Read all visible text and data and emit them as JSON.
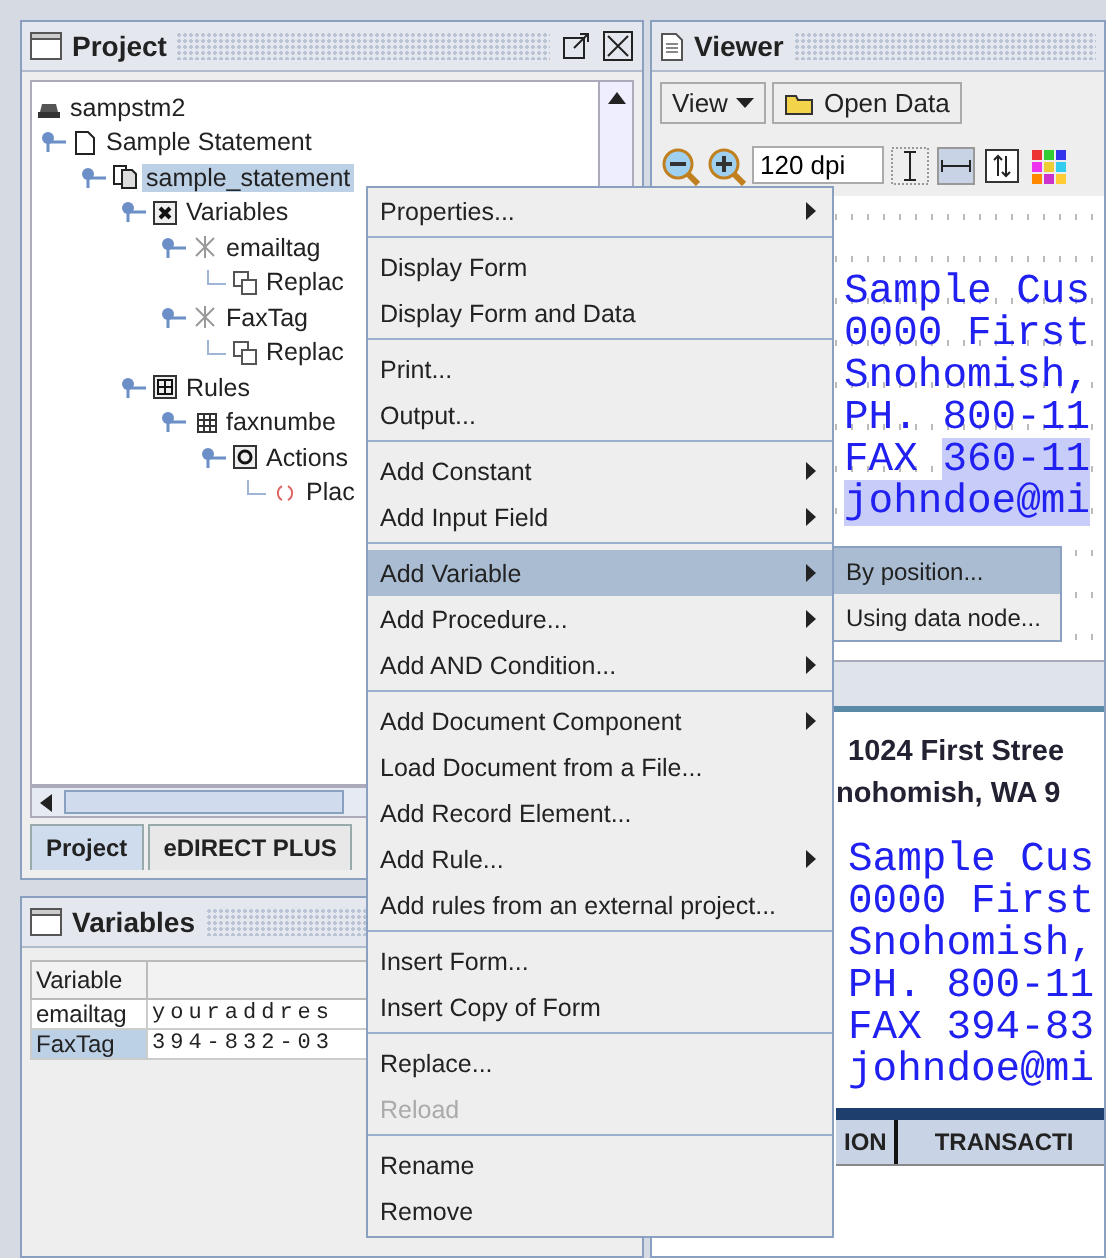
{
  "project_panel": {
    "title": "Project",
    "tree": [
      {
        "label": "sampstm2",
        "kind": "project",
        "selected": false,
        "children": [
          {
            "label": "Sample Statement",
            "kind": "document",
            "selected": false,
            "children": [
              {
                "label": "sample_statement",
                "kind": "form",
                "selected": true,
                "children": [
                  {
                    "label": "Variables",
                    "kind": "variables",
                    "selected": false,
                    "children": [
                      {
                        "label": "emailtag",
                        "kind": "variable",
                        "selected": false,
                        "children": [
                          {
                            "label": "Replac",
                            "kind": "replace",
                            "selected": false
                          }
                        ]
                      },
                      {
                        "label": "FaxTag",
                        "kind": "variable",
                        "selected": false,
                        "children": [
                          {
                            "label": "Replac",
                            "kind": "replace",
                            "selected": false
                          }
                        ]
                      }
                    ]
                  },
                  {
                    "label": "Rules",
                    "kind": "rules",
                    "selected": false,
                    "children": [
                      {
                        "label": "faxnumbe",
                        "kind": "rule",
                        "selected": false,
                        "children": [
                          {
                            "label": "Actions",
                            "kind": "actions",
                            "selected": false,
                            "children": [
                              {
                                "label": "Plac",
                                "kind": "placeholder",
                                "selected": false
                              }
                            ]
                          }
                        ]
                      }
                    ]
                  }
                ]
              }
            ]
          }
        ]
      }
    ],
    "tabs": [
      {
        "label": "Project",
        "selected": true
      },
      {
        "label": "eDIRECT PLUS",
        "selected": false
      }
    ]
  },
  "variables_panel": {
    "title": "Variables",
    "columns": [
      "Variable"
    ],
    "rows": [
      {
        "name": "emailtag",
        "value": "youraddres",
        "selected": false
      },
      {
        "name": "FaxTag",
        "value": "394-832-03",
        "selected": true
      }
    ]
  },
  "viewer": {
    "title": "Viewer",
    "view_menu": "View",
    "open_data": "Open Data",
    "dpi": "120 dpi",
    "page1": [
      {
        "text": "Sample Cus"
      },
      {
        "text": "0000 First"
      },
      {
        "text": "Snohomish,"
      },
      {
        "text": "PH. 800-11"
      },
      {
        "text": "FAX ",
        "highlight": "360-11"
      },
      {
        "highlight": "johndoe@mi"
      }
    ],
    "page2_heading": [
      "1024 First Stree",
      "nohomish, WA 9"
    ],
    "page2": [
      "Sample Cus",
      "0000 First",
      "Snohomish,",
      "PH. 800-11",
      "FAX 394-83",
      "johndoe@mi"
    ],
    "table_headers": [
      "ION",
      "TRANSACTI"
    ]
  },
  "context_menu": [
    [
      {
        "label": "Properties...",
        "submenu": true,
        "disabled": false,
        "selected": false
      }
    ],
    [
      {
        "label": "Display Form",
        "submenu": false,
        "disabled": false,
        "selected": false
      },
      {
        "label": "Display Form and Data",
        "submenu": false,
        "disabled": false,
        "selected": false
      }
    ],
    [
      {
        "label": "Print...",
        "submenu": false,
        "disabled": false,
        "selected": false
      },
      {
        "label": "Output...",
        "submenu": false,
        "disabled": false,
        "selected": false
      }
    ],
    [
      {
        "label": "Add Constant",
        "submenu": true,
        "disabled": false,
        "selected": false
      },
      {
        "label": "Add Input Field",
        "submenu": true,
        "disabled": false,
        "selected": false
      }
    ],
    [
      {
        "label": "Add Variable",
        "submenu": true,
        "disabled": false,
        "selected": true
      },
      {
        "label": "Add Procedure...",
        "submenu": true,
        "disabled": false,
        "selected": false
      },
      {
        "label": "Add AND Condition...",
        "submenu": true,
        "disabled": false,
        "selected": false
      }
    ],
    [
      {
        "label": "Add Document Component",
        "submenu": true,
        "disabled": false,
        "selected": false
      },
      {
        "label": "Load Document from a File...",
        "submenu": false,
        "disabled": false,
        "selected": false
      },
      {
        "label": "Add Record Element...",
        "submenu": false,
        "disabled": false,
        "selected": false
      },
      {
        "label": "Add Rule...",
        "submenu": true,
        "disabled": false,
        "selected": false
      },
      {
        "label": "Add rules from an external project...",
        "submenu": false,
        "disabled": false,
        "selected": false
      }
    ],
    [
      {
        "label": "Insert Form...",
        "submenu": false,
        "disabled": false,
        "selected": false
      },
      {
        "label": "Insert Copy of Form",
        "submenu": false,
        "disabled": false,
        "selected": false
      }
    ],
    [
      {
        "label": "Replace...",
        "submenu": false,
        "disabled": false,
        "selected": false
      },
      {
        "label": "Reload",
        "submenu": false,
        "disabled": true,
        "selected": false
      }
    ],
    [
      {
        "label": "Rename",
        "submenu": false,
        "disabled": false,
        "selected": false
      },
      {
        "label": "Remove",
        "submenu": false,
        "disabled": false,
        "selected": false
      }
    ]
  ],
  "submenu": [
    {
      "label": "By position...",
      "selected": true
    },
    {
      "label": "Using data node...",
      "selected": false
    }
  ]
}
